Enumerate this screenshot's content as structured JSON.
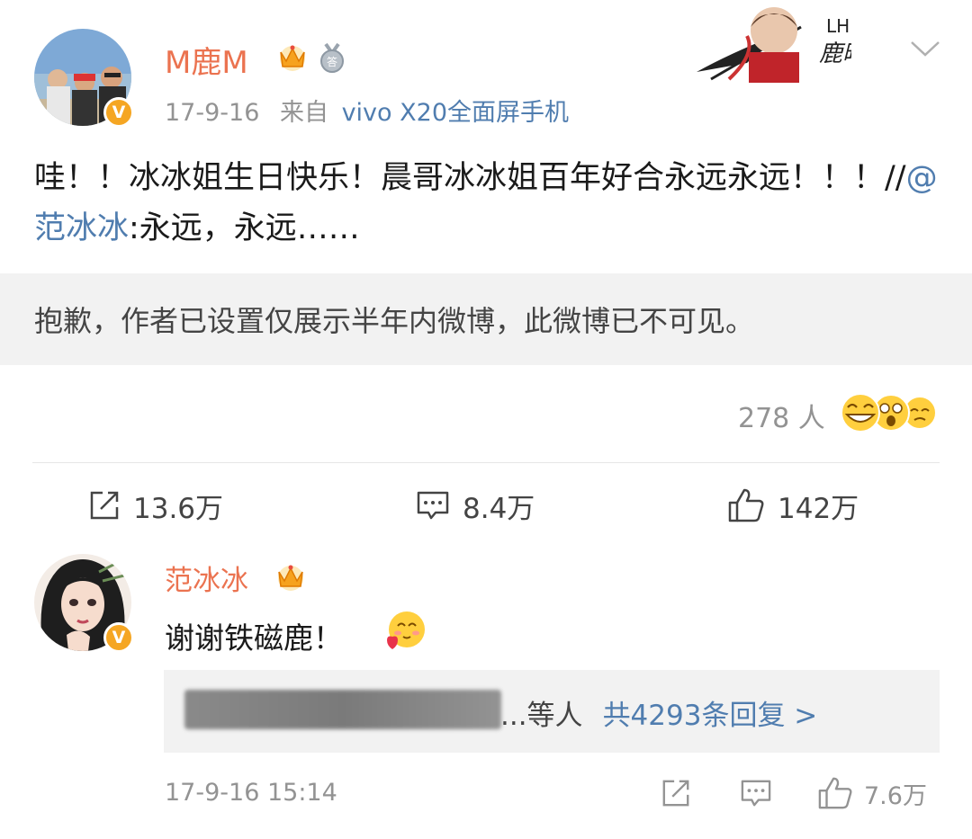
{
  "post": {
    "author": "M鹿M",
    "meta_time": "17-9-16",
    "meta_from": "来自",
    "meta_device": "vivo X20全面屏手机",
    "vip_badge": "V",
    "content_main": "哇！！冰冰姐生日快乐！晨哥冰冰姐百年好合永远永远！！！//",
    "mention": "@范冰冰",
    "content_quote": ":永远，永远……",
    "hidden_notice": "抱歉，作者已设置仅展示半年内微博，此微博已不可见。",
    "reaction_count": "278 人",
    "repost_count": "13.6万",
    "comment_count": "8.4万",
    "like_count": "142万",
    "banner_text": "鹿晗"
  },
  "comment": {
    "author": "范冰冰",
    "vip_badge": "V",
    "text": "谢谢铁磁鹿！",
    "reply_others": "...等人",
    "reply_total": "共4293条回复 >",
    "time": "17-9-16 15:14",
    "like_count": "7.6万"
  },
  "colors": {
    "name_orange": "#eb7350",
    "link_blue": "#507daf",
    "meta_gray": "#939393",
    "panel_gray": "#f2f2f2",
    "badge_gold": "#f5a623"
  },
  "icons": [
    "chevron-down-icon",
    "crown-icon",
    "medal-icon",
    "repost-icon",
    "comment-icon",
    "like-icon",
    "verified-icon"
  ]
}
